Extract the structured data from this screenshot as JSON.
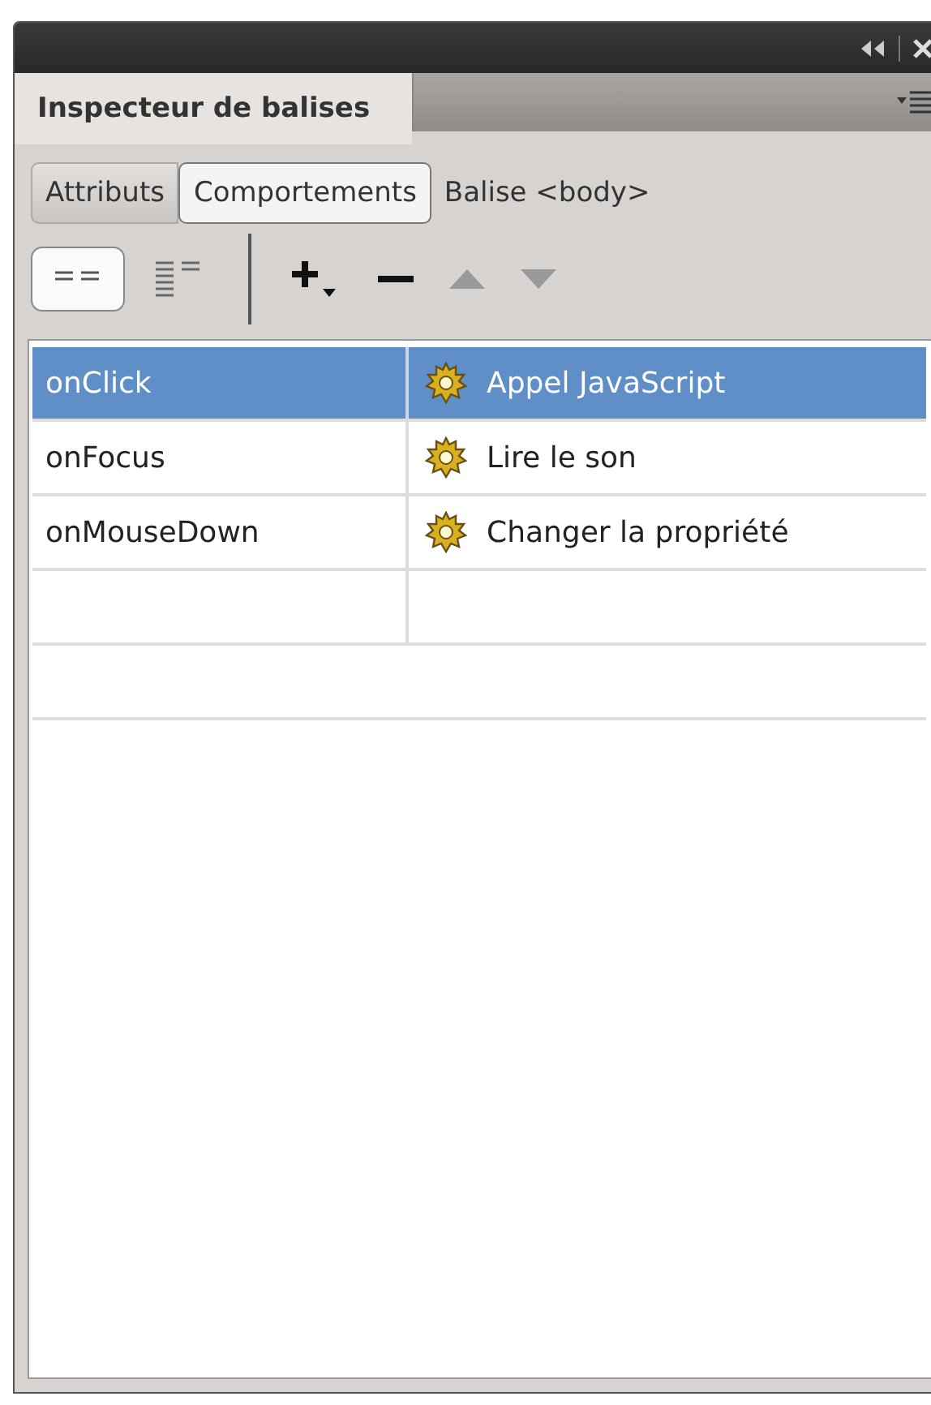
{
  "panel": {
    "tab": "Inspecteur de balises"
  },
  "subtabs": [
    {
      "label": "Attributs",
      "selected": false
    },
    {
      "label": "Comportements",
      "selected": true
    }
  ],
  "tag_label": "Balise <body>",
  "view_buttons": [
    {
      "kind": "category",
      "selected": true
    },
    {
      "kind": "list",
      "selected": false
    }
  ],
  "behaviors": [
    {
      "event": "onClick",
      "action": "Appel JavaScript",
      "selected": true
    },
    {
      "event": "onFocus",
      "action": "Lire le son",
      "selected": false
    },
    {
      "event": "onMouseDown",
      "action": "Changer la propriété",
      "selected": false
    }
  ]
}
